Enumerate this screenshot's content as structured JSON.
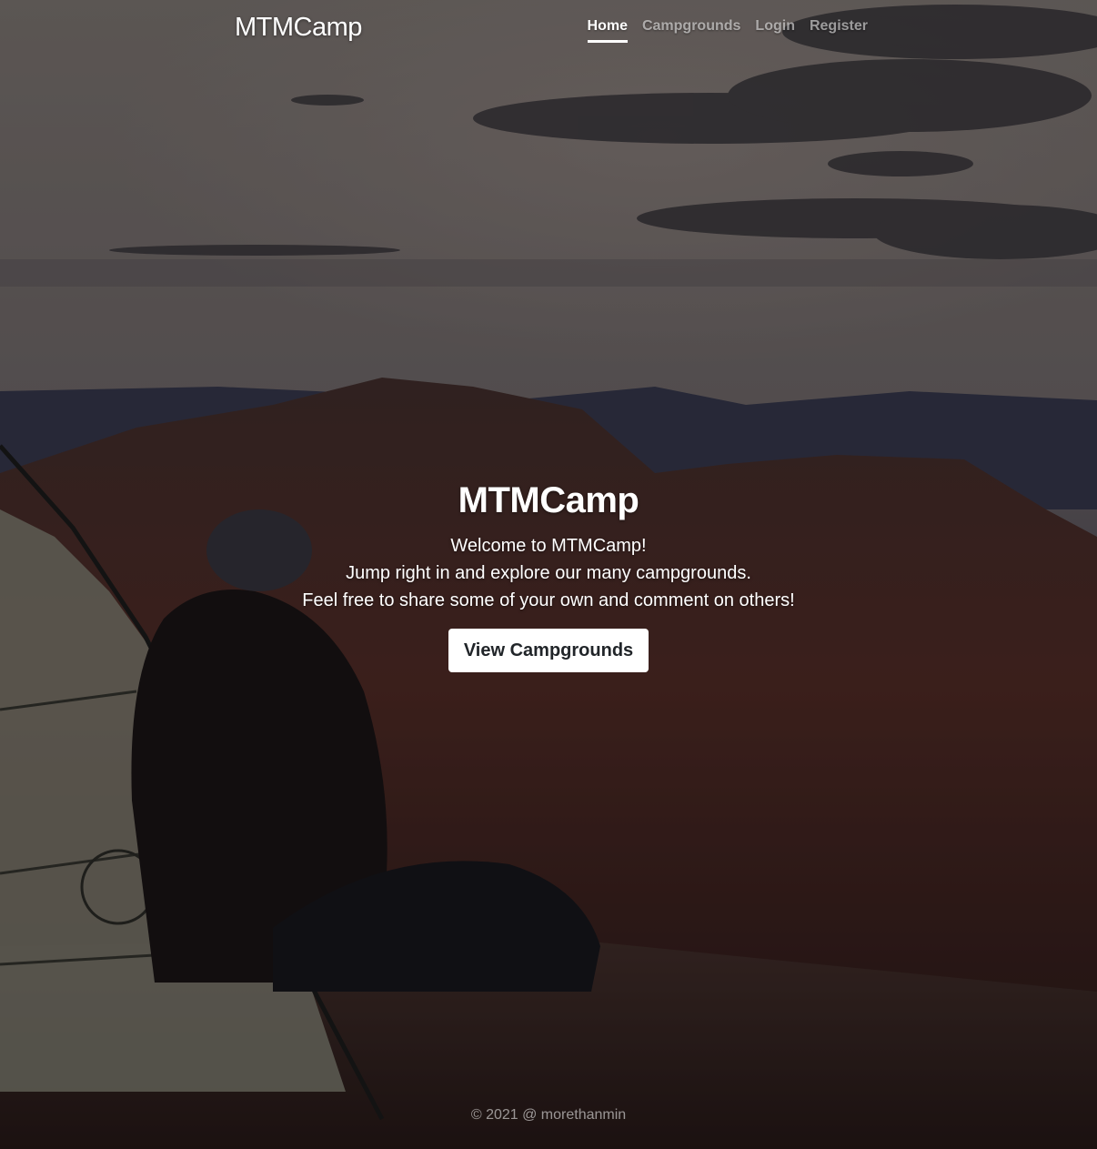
{
  "header": {
    "brand": "MTMCamp",
    "nav": [
      {
        "label": "Home",
        "active": true
      },
      {
        "label": "Campgrounds",
        "active": false
      },
      {
        "label": "Login",
        "active": false
      },
      {
        "label": "Register",
        "active": false
      }
    ]
  },
  "hero": {
    "title": "MTMCamp",
    "lines": [
      "Welcome to MTMCamp!",
      "Jump right in and explore our many campgrounds.",
      "Feel free to share some of your own and comment on others!"
    ],
    "button_label": "View Campgrounds"
  },
  "footer": {
    "text": "© 2021 @ morethanmin"
  },
  "colors": {
    "accent": "#ffffff",
    "nav_inactive": "#9b9a99",
    "button_text": "#212529"
  }
}
